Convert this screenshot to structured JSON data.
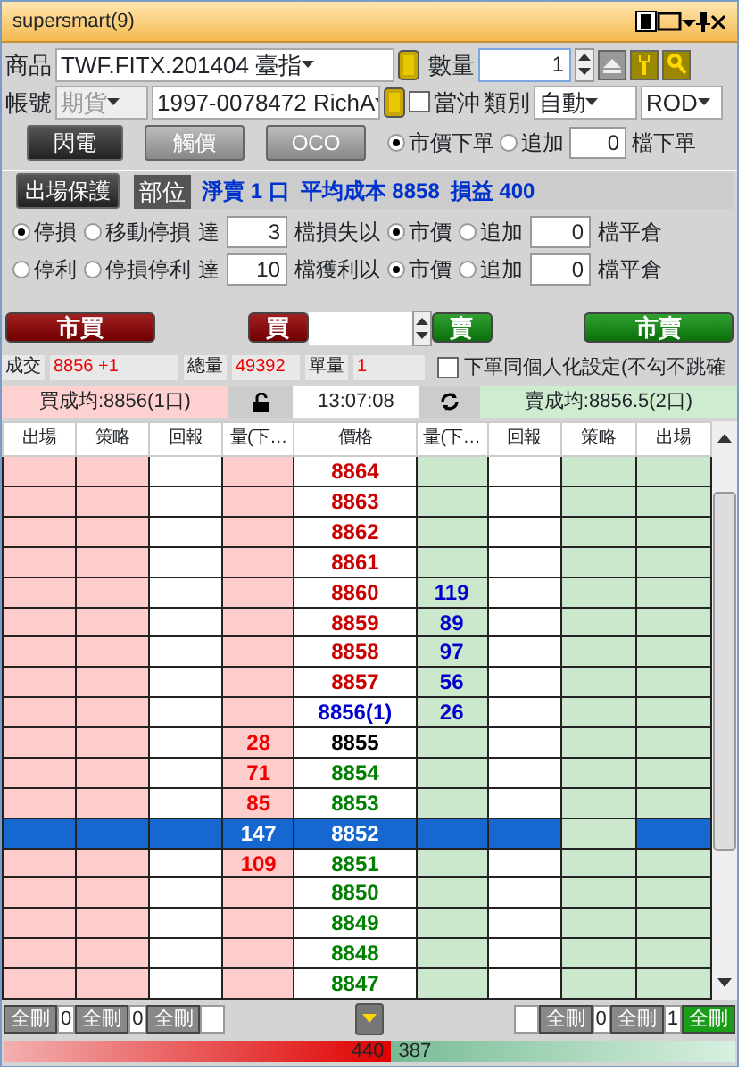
{
  "window": {
    "title": "supersmart(9)"
  },
  "order_form": {
    "product": {
      "label": "商品",
      "value": "TWF.FITX.201404 臺指"
    },
    "quantity": {
      "label": "數量",
      "value": "1"
    },
    "account": {
      "label": "帳號",
      "market": "期貨",
      "value": "1997-0078472 RichA"
    },
    "day_trade": {
      "label": "當沖",
      "checked": false
    },
    "category": {
      "label": "類別",
      "value": "自動"
    },
    "time_in_force": "ROD",
    "mode_buttons": [
      {
        "label": "閃電",
        "selected": true
      },
      {
        "label": "觸價",
        "selected": false
      },
      {
        "label": "OCO",
        "selected": false
      }
    ],
    "order_price": {
      "options": [
        {
          "label": "市價下單",
          "selected": true
        },
        {
          "label": "追加",
          "selected": false
        }
      ],
      "ticks": "0",
      "suffix": "檔下單"
    }
  },
  "position": {
    "button": "出場保護",
    "label": "部位",
    "net": "淨賣 1 口",
    "avg_cost": "平均成本 8858",
    "pnl": "損益 400"
  },
  "exit_rules": [
    {
      "types": [
        {
          "label": "停損",
          "selected": true
        },
        {
          "label": "移動停損",
          "selected": false
        }
      ],
      "reach": "達",
      "ticks": "3",
      "trigger": "檔損失以",
      "price_options": [
        {
          "label": "市價",
          "selected": true
        },
        {
          "label": "追加",
          "selected": false
        }
      ],
      "add_ticks": "0",
      "suffix": "檔平倉"
    },
    {
      "types": [
        {
          "label": "停利",
          "selected": false
        },
        {
          "label": "停損停利",
          "selected": false
        }
      ],
      "reach": "達",
      "ticks": "10",
      "trigger": "檔獲利以",
      "price_options": [
        {
          "label": "市價",
          "selected": true
        },
        {
          "label": "追加",
          "selected": false
        }
      ],
      "add_ticks": "0",
      "suffix": "檔平倉"
    }
  ],
  "trade_bar": {
    "market_buy": "市買",
    "buy": "買",
    "sell": "賣",
    "market_sell": "市賣"
  },
  "quote": {
    "last_label": "成交",
    "last": "8856 +1",
    "volume_label": "總量",
    "volume": "49392",
    "lot_label": "單量",
    "lot": "1",
    "personal": {
      "label": "下單同個人化設定(不勾不跳確",
      "checked": false
    }
  },
  "averages": {
    "buy": "買成均:8856(1口)",
    "time": "13:07:08",
    "sell": "賣成均:8856.5(2口)"
  },
  "ladder": {
    "columns": [
      "出場",
      "策略",
      "回報",
      "量(下…",
      "價格",
      "量(下…",
      "回報",
      "策略",
      "出場"
    ],
    "rows": [
      {
        "price": "8864",
        "color": "#cc0000",
        "selected": false
      },
      {
        "price": "8863",
        "color": "#cc0000",
        "selected": false
      },
      {
        "price": "8862",
        "color": "#cc0000",
        "selected": false
      },
      {
        "price": "8861",
        "color": "#cc0000",
        "selected": false
      },
      {
        "price": "8860",
        "color": "#cc0000",
        "ask_qty": "119",
        "selected": false
      },
      {
        "price": "8859",
        "color": "#cc0000",
        "ask_qty": "89",
        "selected": false
      },
      {
        "price": "8858",
        "color": "#cc0000",
        "ask_qty": "97",
        "selected": false
      },
      {
        "price": "8857",
        "color": "#cc0000",
        "ask_qty": "56",
        "selected": false
      },
      {
        "price": "8856(1)",
        "color": "#0000cc",
        "ask_qty": "26",
        "selected": false
      },
      {
        "price": "8855",
        "color": "#000000",
        "bid_qty": "28",
        "selected": false
      },
      {
        "price": "8854",
        "color": "#008000",
        "bid_qty": "71",
        "selected": false
      },
      {
        "price": "8853",
        "color": "#008000",
        "bid_qty": "85",
        "selected": false
      },
      {
        "price": "8852",
        "bid_qty": "147",
        "selected": true
      },
      {
        "price": "8851",
        "color": "#008000",
        "bid_qty": "109",
        "selected": false
      },
      {
        "price": "8850",
        "color": "#008000",
        "selected": false
      },
      {
        "price": "8849",
        "color": "#008000",
        "selected": false
      },
      {
        "price": "8848",
        "color": "#008000",
        "selected": false
      },
      {
        "price": "8847",
        "color": "#008000",
        "selected": false
      }
    ]
  },
  "footer": {
    "left": [
      {
        "kind": "button",
        "label": "全刪",
        "active": false
      },
      {
        "kind": "count",
        "value": "0"
      },
      {
        "kind": "button",
        "label": "全刪",
        "active": false
      },
      {
        "kind": "count",
        "value": "0"
      },
      {
        "kind": "button",
        "label": "全刪",
        "active": false
      },
      {
        "kind": "count"
      }
    ],
    "right": [
      {
        "kind": "count"
      },
      {
        "kind": "button",
        "label": "全刪",
        "active": false
      },
      {
        "kind": "count",
        "value": "0"
      },
      {
        "kind": "button",
        "label": "全刪",
        "active": false
      },
      {
        "kind": "count",
        "value": "1"
      },
      {
        "kind": "button",
        "label": "全刪",
        "active": true
      }
    ]
  },
  "balance": {
    "buy": "440",
    "sell": "387",
    "level": 0.53
  }
}
